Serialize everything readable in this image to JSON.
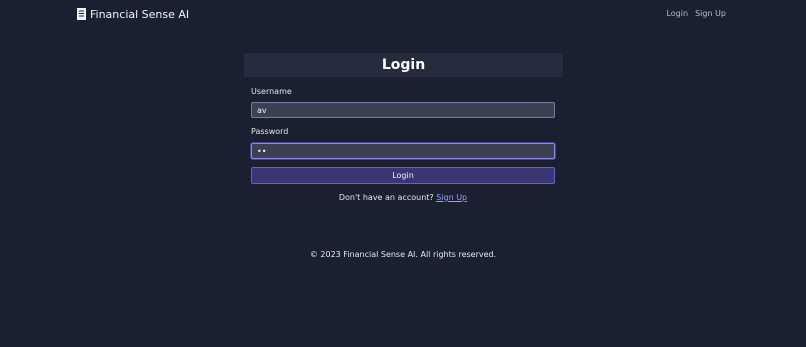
{
  "header": {
    "brand_name": "Financial Sense AI",
    "brand_icon": "document-icon",
    "nav": {
      "login_label": "Login",
      "signup_label": "Sign Up"
    }
  },
  "login_form": {
    "title": "Login",
    "username_label": "Username",
    "username_value": "av",
    "password_label": "Password",
    "password_value": "ab",
    "submit_label": "Login",
    "signup_prompt": "Don't have an account?",
    "signup_link": "Sign Up"
  },
  "footer": {
    "copyright": "© 2023 Financial Sense AI. All rights reserved."
  },
  "colors": {
    "background": "#1b2030",
    "card_header": "#262c3d",
    "input_bg": "#3a4153",
    "button_bg": "#3b3475",
    "button_border": "#6a5fc4",
    "link": "#8fa2ff"
  }
}
